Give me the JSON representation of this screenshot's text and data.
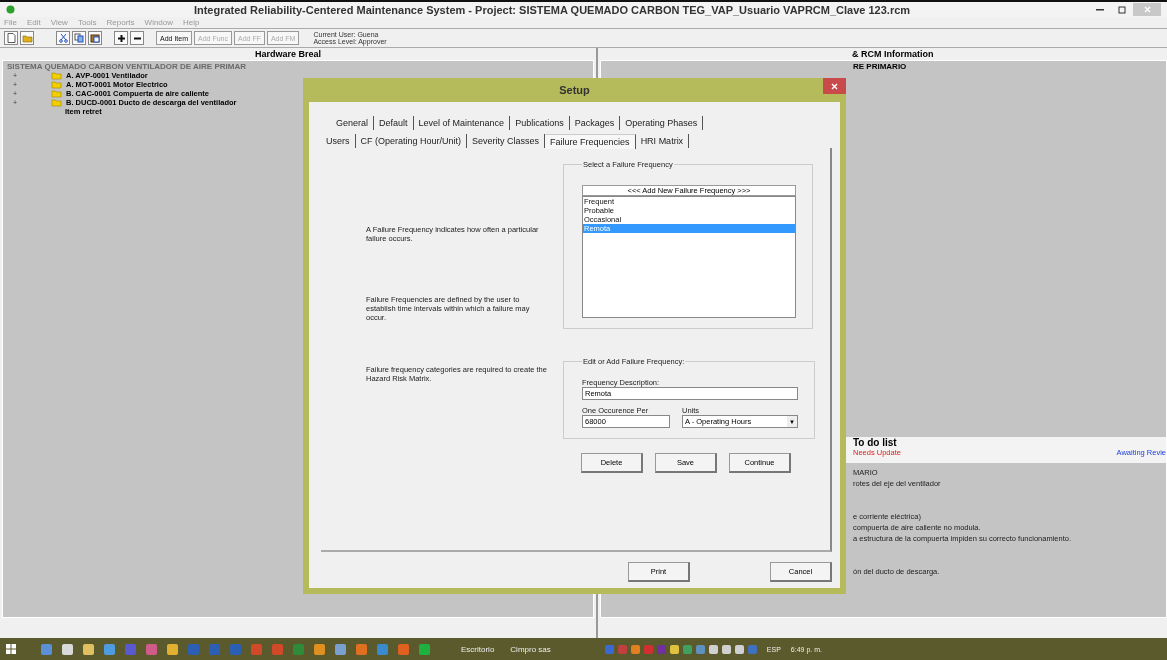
{
  "window": {
    "title": "Integrated Reliability-Centered Maintenance System  -  Project: SISTEMA QUEMADO CARBON TEG_VAP_Usuario VAPRCM_Clave 123.rcm"
  },
  "menu": [
    "File",
    "Edit",
    "View",
    "Tools",
    "Reports",
    "Window",
    "Help"
  ],
  "toolbar": {
    "text_buttons": [
      {
        "label": "Add Item",
        "disabled": false
      },
      {
        "label": "Add Func",
        "disabled": true
      },
      {
        "label": "Add FF",
        "disabled": true
      },
      {
        "label": "Add FM",
        "disabled": true
      }
    ],
    "user": "Current User: Guena",
    "access": "Access Level: Approver"
  },
  "left_pane": {
    "header": "Hardware Breal",
    "root": "SISTEMA QUEMADO CARBON  VENTILADOR DE AIRE PRIMAR",
    "items": [
      {
        "expander": "+",
        "code": "A. AVP-0001",
        "name": "Ventilador",
        "kind": "folder"
      },
      {
        "expander": "+",
        "code": "A. MOT-0001",
        "name": "Motor Electrico",
        "kind": "folder"
      },
      {
        "expander": "+",
        "code": "B. CAC-0001",
        "name": "Compuerta de aire caliente",
        "kind": "folder"
      },
      {
        "expander": "+",
        "code": "B. DUCD-0001",
        "name": "Ducto de descarga del ventilador",
        "kind": "folder"
      },
      {
        "name": "Item retret",
        "kind": "leaf"
      }
    ]
  },
  "right_pane": {
    "header": "& RCM Information",
    "subheader": "RE PRIMARIO",
    "todo_title": "To do list",
    "needs_update": "Needs Update",
    "awaiting_review": "Awaiting Revie",
    "paragraphs": [
      [
        "MARIO",
        "rotes del eje del ventilador"
      ],
      [
        "e corriente eléctrica)",
        "compuerta de aire caliente no modula.",
        "a estructura de la compuerta impiden su correcto funcionamiento."
      ],
      [
        "ón del ducto de descarga."
      ]
    ]
  },
  "dialog": {
    "title": "Setup",
    "tab_rows": [
      [
        {
          "label": "General",
          "selected": false
        },
        {
          "label": "Default",
          "selected": false
        },
        {
          "label": "Level of Maintenance",
          "selected": false
        },
        {
          "label": "Publications",
          "selected": false
        },
        {
          "label": "Packages",
          "selected": false
        },
        {
          "label": "Operating Phases",
          "selected": false
        }
      ],
      [
        {
          "label": "Users",
          "selected": false
        },
        {
          "label": "CF (Operating Hour/Unit)",
          "selected": false
        },
        {
          "label": "Severity Classes",
          "selected": false
        },
        {
          "label": "Failure Frequencies",
          "selected": true
        },
        {
          "label": "HRI Matrix",
          "selected": false
        }
      ]
    ],
    "descriptions": [
      "A Failure Frequency indicates how often a particular failure occurs.",
      "Failure Frequencies are defined by the user to establish time intervals within which a failure may occur.",
      "Failure frequency categories are required to create the Hazard Risk Matrix."
    ],
    "select_group": {
      "title": "Select a Failure Frequency",
      "add_button": "<<<  Add New Failure Frequency  >>>",
      "items": [
        {
          "label": "Frequent",
          "selected": false
        },
        {
          "label": "Probable",
          "selected": false
        },
        {
          "label": "Occasional",
          "selected": false
        },
        {
          "label": "Remota",
          "selected": true
        }
      ]
    },
    "edit_group": {
      "title": "Edit or Add Failure Frequency:",
      "description_label": "Frequency Description:",
      "description_value": "Remota",
      "occurrence_label": "One Occurence Per",
      "occurrence_value": "68000",
      "units_label": "Units",
      "units_value": "A - Operating Hours",
      "units_arrow": "▼"
    },
    "actions": [
      "Delete",
      "Save",
      "Continue"
    ],
    "footer": [
      "Print",
      "Cancel"
    ]
  },
  "taskbar": {
    "apps": [
      {
        "color": "#5b8fd6"
      },
      {
        "color": "#d9d9d9"
      },
      {
        "color": "#e0c060"
      },
      {
        "color": "#4f9be0"
      },
      {
        "color": "#5a5ad0"
      },
      {
        "color": "#d05a8a"
      },
      {
        "color": "#e0b030"
      },
      {
        "color": "#2b5fb4"
      },
      {
        "color": "#2b5fb4"
      },
      {
        "color": "#2b5fb4"
      },
      {
        "color": "#d04a2a"
      },
      {
        "color": "#d04a2a"
      },
      {
        "color": "#2f8a3a"
      },
      {
        "color": "#e09020"
      },
      {
        "color": "#7aa0d0"
      },
      {
        "color": "#e07020"
      },
      {
        "color": "#3a8ad0"
      },
      {
        "color": "#e06020"
      },
      {
        "color": "#20b040"
      }
    ],
    "windows": [
      "Escritorio",
      "Cimpro sas"
    ],
    "tray": [
      {
        "color": "#3a6ad0"
      },
      {
        "color": "#c04040"
      },
      {
        "color": "#e08020"
      },
      {
        "color": "#d03030"
      },
      {
        "color": "#7030a0"
      },
      {
        "color": "#e0c040"
      },
      {
        "color": "#40a060"
      },
      {
        "color": "#6090c0"
      },
      {
        "color": "#d0d0d0"
      },
      {
        "color": "#d0d0d0"
      },
      {
        "color": "#d0d0d0"
      },
      {
        "color": "#4070c0"
      }
    ],
    "language": "ESP",
    "clock": "6:49 p. m."
  }
}
